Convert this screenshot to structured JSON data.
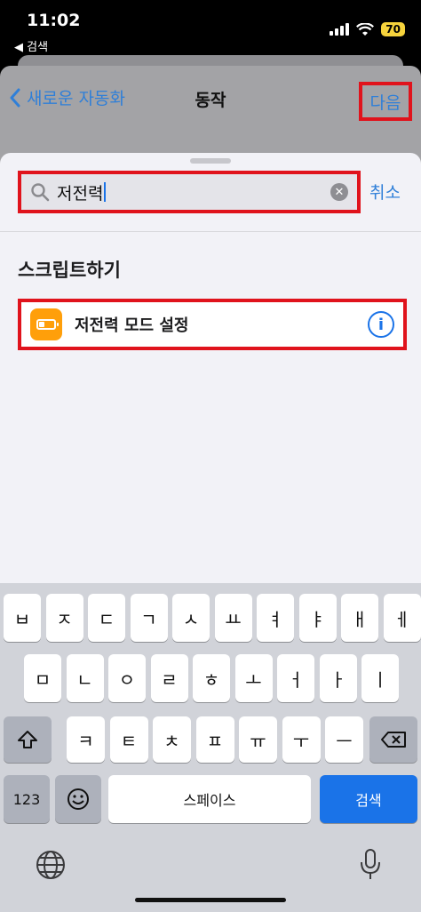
{
  "status_bar": {
    "time": "11:02",
    "back_label": "◀ 검색",
    "battery": "70"
  },
  "nav": {
    "back_label": "새로운 자동화",
    "title": "동작",
    "next_label": "다음"
  },
  "search": {
    "value": "저전력",
    "cancel_label": "취소"
  },
  "section": {
    "title": "스크립트하기"
  },
  "result": {
    "label": "저전력 모드 설정"
  },
  "keyboard": {
    "row1": [
      "ㅂ",
      "ㅈ",
      "ㄷ",
      "ㄱ",
      "ㅅ",
      "ㅛ",
      "ㅕ",
      "ㅑ",
      "ㅐ",
      "ㅔ"
    ],
    "row2": [
      "ㅁ",
      "ㄴ",
      "ㅇ",
      "ㄹ",
      "ㅎ",
      "ㅗ",
      "ㅓ",
      "ㅏ",
      "ㅣ"
    ],
    "row3": [
      "ㅋ",
      "ㅌ",
      "ㅊ",
      "ㅍ",
      "ㅠ",
      "ㅜ",
      "ㅡ"
    ],
    "numbers_label": "123",
    "space_label": "스페이스",
    "search_label": "검색"
  },
  "colors": {
    "accent": "#2f7fd8",
    "highlight": "#e0131c",
    "app_icon": "#ff9f0a"
  }
}
